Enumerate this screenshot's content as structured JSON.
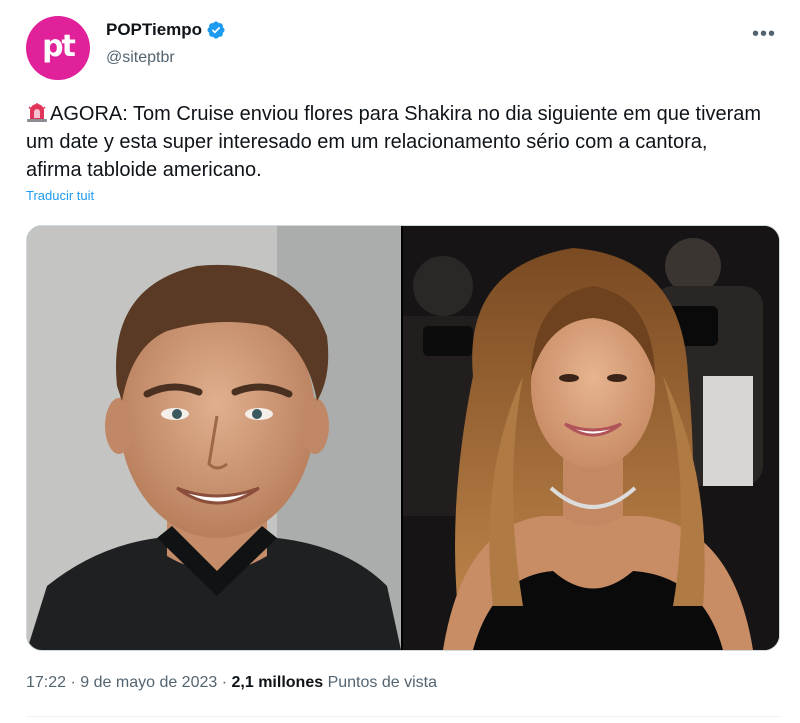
{
  "author": {
    "avatar_text": "pt",
    "display_name": "POPTiempo",
    "handle": "@siteptbr",
    "verified": true
  },
  "tweet": {
    "emoji": "siren-emoji",
    "text": "AGORA: Tom Cruise enviou flores para Shakira no dia siguiente em que tiveram um date y esta super interesado em um relacionamento sério com a cantora, afirma tabloide americano.",
    "translate_label": "Traducir tuit"
  },
  "media": [
    {
      "icon": "photo-man-portrait"
    },
    {
      "icon": "photo-woman-red-carpet"
    }
  ],
  "meta": {
    "time": "17:22",
    "date": "9 de mayo de 2023",
    "separator": "·",
    "views_count": "2,1 millones",
    "views_label": "Puntos de vista"
  },
  "colors": {
    "avatar_bg": "#e0219a",
    "verified": "#1d9bf0",
    "link": "#1d9bf0",
    "secondary_text": "#536471"
  }
}
